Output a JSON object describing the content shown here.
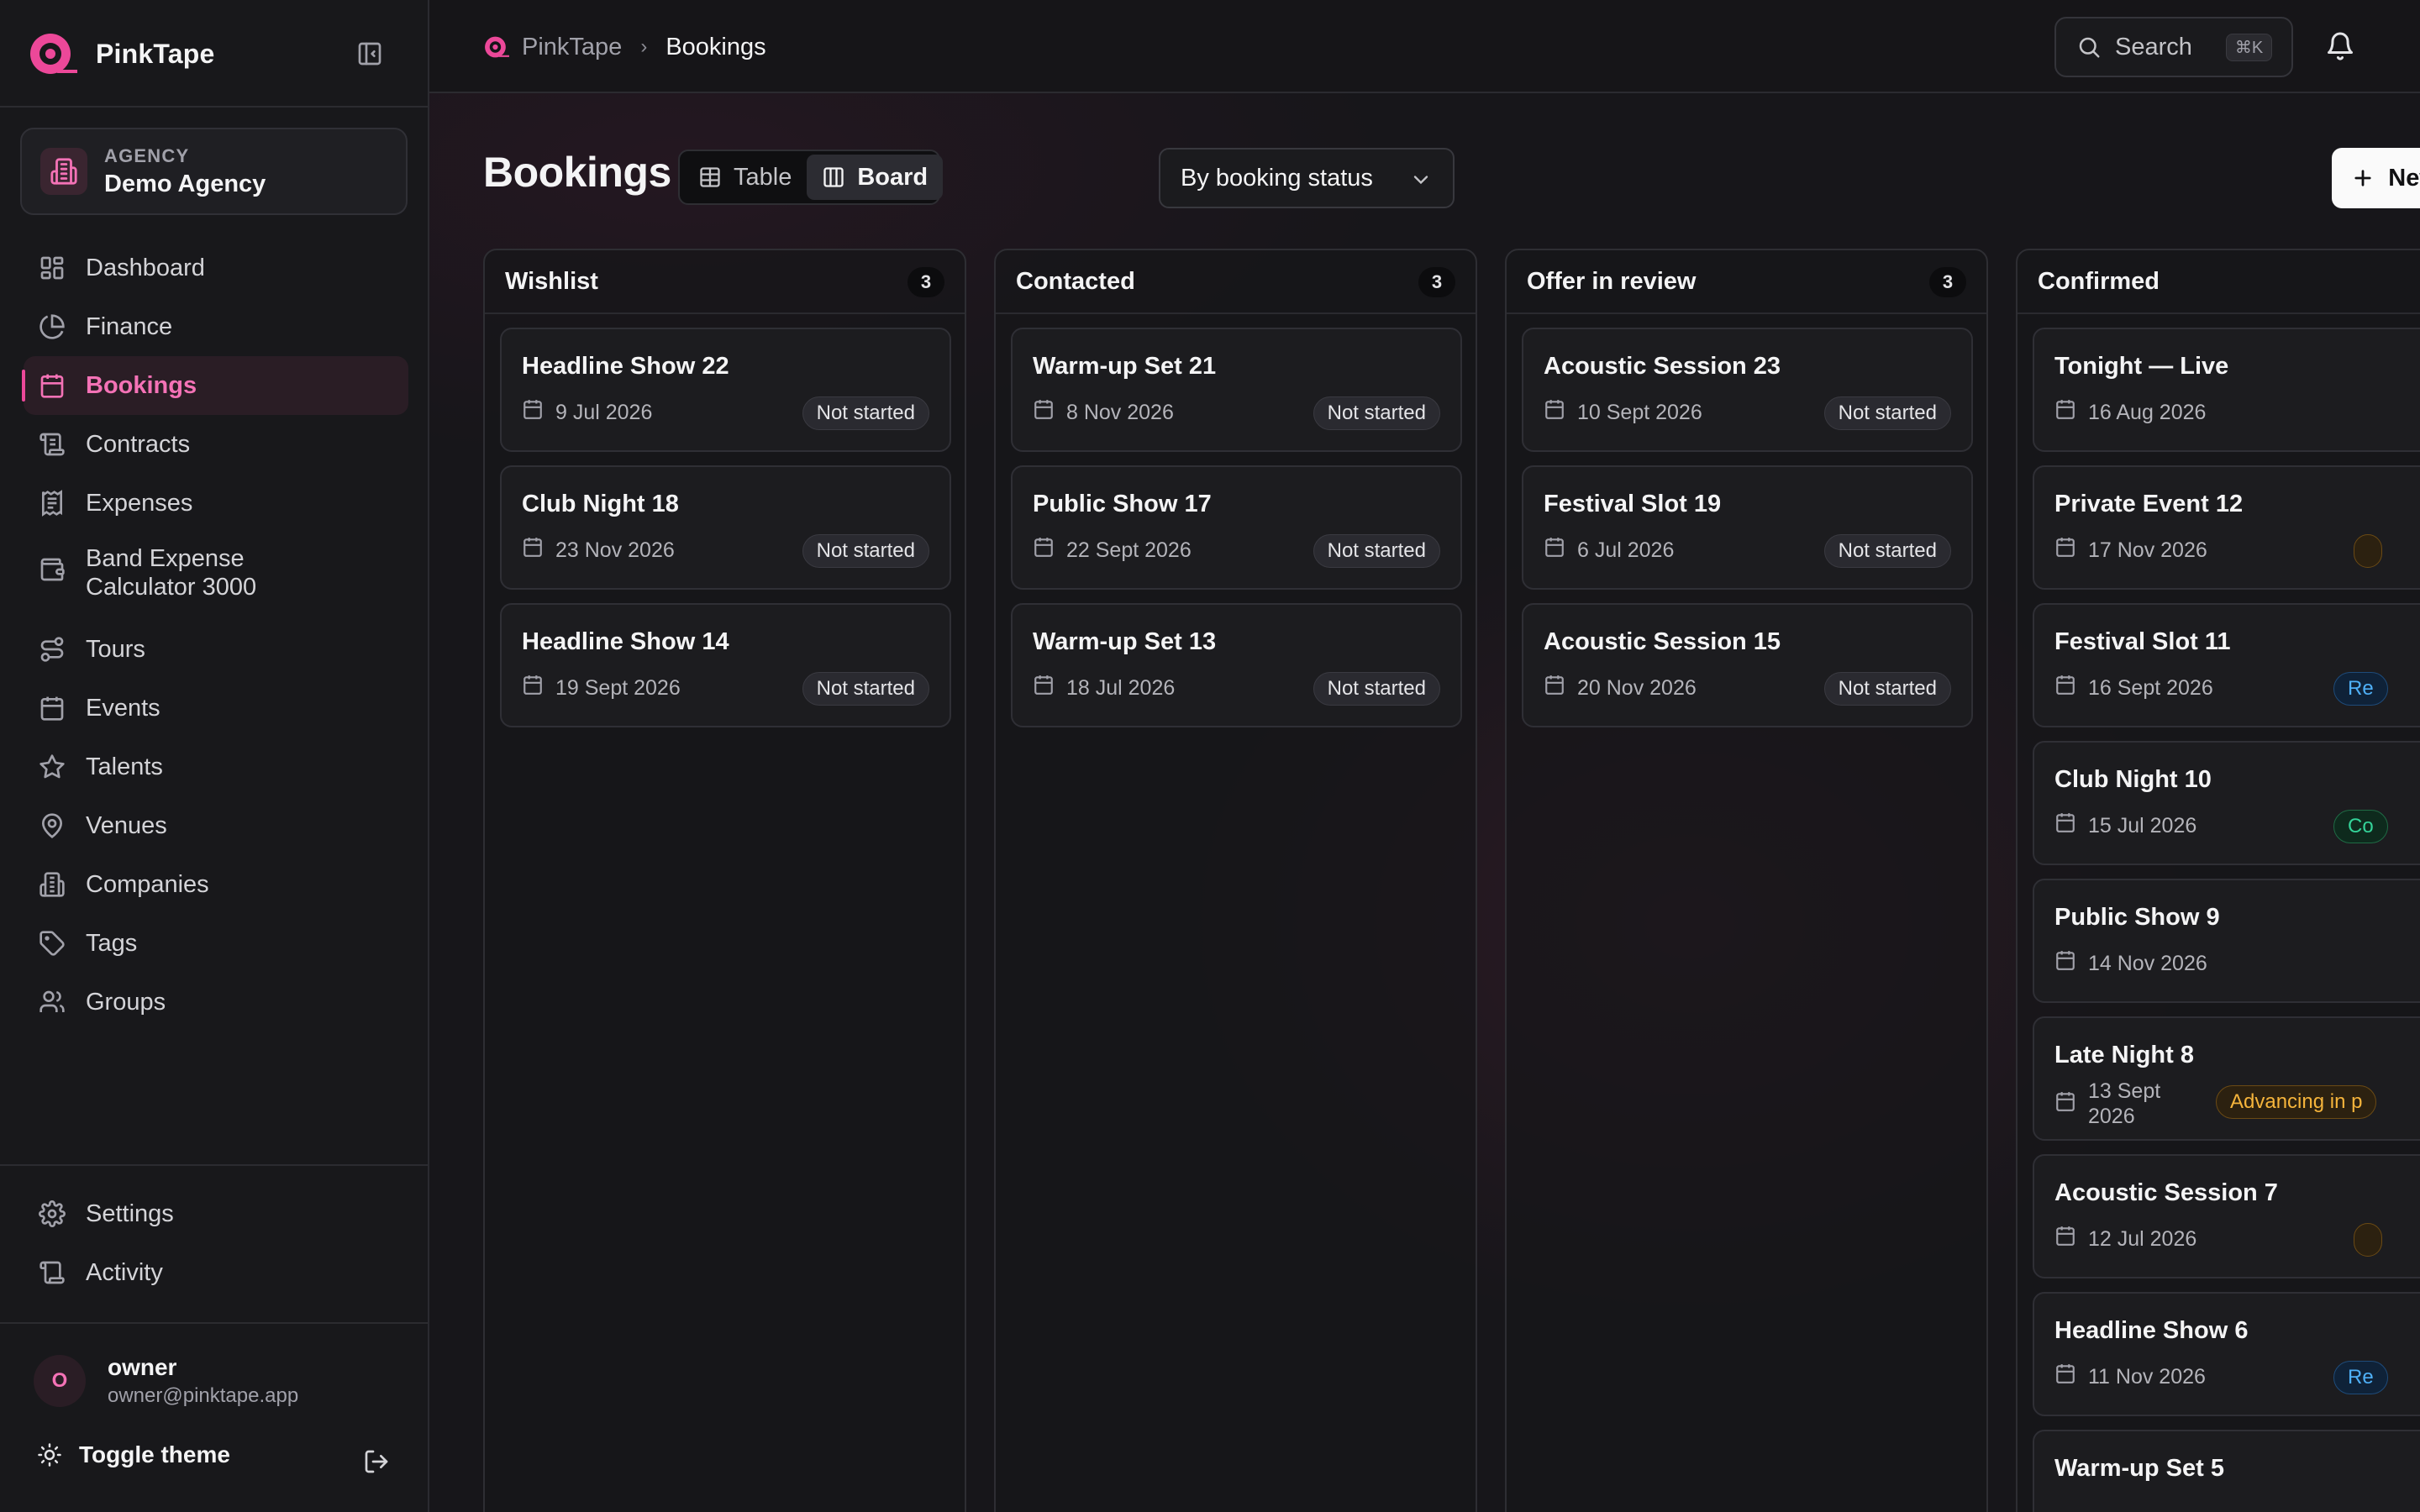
{
  "brand": {
    "name": "PinkTape"
  },
  "agency": {
    "label": "AGENCY",
    "name": "Demo Agency"
  },
  "sidebar": {
    "items": [
      {
        "label": "Dashboard",
        "icon": "dashboard-icon"
      },
      {
        "label": "Finance",
        "icon": "pie-chart-icon"
      },
      {
        "label": "Bookings",
        "icon": "calendar-icon",
        "active": true
      },
      {
        "label": "Contracts",
        "icon": "scroll-icon"
      },
      {
        "label": "Expenses",
        "icon": "receipt-icon"
      },
      {
        "label": "Band Expense Calculator 3000",
        "icon": "wallet-icon"
      },
      {
        "label": "Tours",
        "icon": "route-icon"
      },
      {
        "label": "Events",
        "icon": "calendar-icon"
      },
      {
        "label": "Talents",
        "icon": "star-icon"
      },
      {
        "label": "Venues",
        "icon": "map-pin-icon"
      },
      {
        "label": "Companies",
        "icon": "building-icon"
      },
      {
        "label": "Tags",
        "icon": "tag-icon"
      },
      {
        "label": "Groups",
        "icon": "users-icon"
      }
    ],
    "bottom": [
      {
        "label": "Settings",
        "icon": "gear-icon"
      },
      {
        "label": "Activity",
        "icon": "scroll-icon"
      }
    ],
    "user": {
      "initial": "O",
      "name": "owner",
      "email": "owner@pinktape.app"
    },
    "toggle_theme": "Toggle theme"
  },
  "topbar": {
    "breadcrumb": {
      "root": "PinkTape",
      "current": "Bookings"
    },
    "search": {
      "label": "Search",
      "shortcut": "⌘K"
    }
  },
  "page": {
    "title": "Bookings",
    "view": {
      "table": "Table",
      "board": "Board",
      "active": "Board"
    },
    "group_by": "By booking status",
    "new_button": "New booking"
  },
  "colors": {
    "accent": "#ec4899",
    "amber": "#f5b43b",
    "blue": "#4fb0f7",
    "green": "#34d399"
  },
  "board": {
    "columns": [
      {
        "title": "Wishlist",
        "count": "3",
        "cards": [
          {
            "title": "Headline Show 22",
            "date": "9 Jul 2026",
            "status": "Not started",
            "tone": "neutral"
          },
          {
            "title": "Club Night 18",
            "date": "23 Nov 2026",
            "status": "Not started",
            "tone": "neutral"
          },
          {
            "title": "Headline Show 14",
            "date": "19 Sept 2026",
            "status": "Not started",
            "tone": "neutral"
          }
        ]
      },
      {
        "title": "Contacted",
        "count": "3",
        "cards": [
          {
            "title": "Warm-up Set 21",
            "date": "8 Nov 2026",
            "status": "Not started",
            "tone": "neutral"
          },
          {
            "title": "Public Show 17",
            "date": "22 Sept 2026",
            "status": "Not started",
            "tone": "neutral"
          },
          {
            "title": "Warm-up Set 13",
            "date": "18 Jul 2026",
            "status": "Not started",
            "tone": "neutral"
          }
        ]
      },
      {
        "title": "Offer in review",
        "count": "3",
        "cards": [
          {
            "title": "Acoustic Session 23",
            "date": "10 Sept 2026",
            "status": "Not started",
            "tone": "neutral"
          },
          {
            "title": "Festival Slot 19",
            "date": "6 Jul 2026",
            "status": "Not started",
            "tone": "neutral"
          },
          {
            "title": "Acoustic Session 15",
            "date": "20 Nov 2026",
            "status": "Not started",
            "tone": "neutral"
          }
        ]
      },
      {
        "title": "Confirmed",
        "count": "",
        "cards": [
          {
            "title": "Tonight — Live",
            "date": "16 Aug 2026",
            "status": "",
            "tone": "none"
          },
          {
            "title": "Private Event 12",
            "date": "17 Nov 2026",
            "status": "",
            "tone": "amber"
          },
          {
            "title": "Festival Slot 11",
            "date": "16 Sept 2026",
            "status": "Re",
            "tone": "blue"
          },
          {
            "title": "Club Night 10",
            "date": "15 Jul 2026",
            "status": "Co",
            "tone": "green"
          },
          {
            "title": "Public Show 9",
            "date": "14 Nov 2026",
            "status": "",
            "tone": "none"
          },
          {
            "title": "Late Night 8",
            "date": "13 Sept 2026",
            "status": "Advancing in p",
            "tone": "amber"
          },
          {
            "title": "Acoustic Session 7",
            "date": "12 Jul 2026",
            "status": "",
            "tone": "amber"
          },
          {
            "title": "Headline Show 6",
            "date": "11 Nov 2026",
            "status": "Re",
            "tone": "blue"
          },
          {
            "title": "Warm-up Set 5",
            "date": "",
            "status": "",
            "tone": "none"
          }
        ]
      }
    ]
  }
}
